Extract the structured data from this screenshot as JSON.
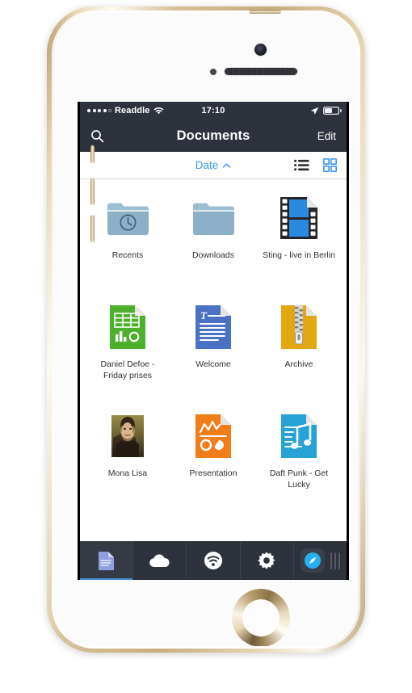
{
  "device": {
    "name": "iphone-5s-gold",
    "body_color": "#c6ad7f",
    "face_color": "#ffffff"
  },
  "status_bar": {
    "carrier": "Readdle",
    "signal_dots_filled": 4,
    "signal_dots_total": 5,
    "wifi_icon": "wifi-icon",
    "time": "17:10",
    "location_icon": "location-arrow-icon",
    "battery_icon": "battery-icon",
    "background": "#2e323c"
  },
  "nav_bar": {
    "search_icon": "search-icon",
    "title": "Documents",
    "edit_label": "Edit",
    "background": "#2e323c"
  },
  "sort_bar": {
    "sort_label": "Date",
    "sort_direction_icon": "chevron-up-icon",
    "accent_color": "#3b97f0",
    "views": [
      {
        "name": "list-view-toggle",
        "icon": "list-icon",
        "active": false,
        "color": "#2b2b2b"
      },
      {
        "name": "grid-view-toggle",
        "icon": "grid-icon",
        "active": true,
        "color": "#3b97f0"
      }
    ]
  },
  "files": [
    {
      "label": "Recents",
      "icon": "folder-clock-icon",
      "type": "folder"
    },
    {
      "label": "Downloads",
      "icon": "folder-icon",
      "type": "folder"
    },
    {
      "label": "Sting - live in Berlin",
      "icon": "video-film-icon",
      "type": "video"
    },
    {
      "label": "Daniel Defoe - Friday prises",
      "icon": "spreadsheet-icon",
      "type": "spreadsheet"
    },
    {
      "label": "Welcome",
      "icon": "text-document-icon",
      "type": "document"
    },
    {
      "label": "Archive",
      "icon": "zip-archive-icon",
      "type": "archive"
    },
    {
      "label": "Mona Lisa",
      "icon": "image-thumbnail-icon",
      "type": "image"
    },
    {
      "label": "Presentation",
      "icon": "presentation-icon",
      "type": "presentation"
    },
    {
      "label": "Daft Punk - Get Lucky",
      "icon": "music-note-icon",
      "type": "audio"
    }
  ],
  "tab_bar": {
    "background": "#2e323c",
    "active_indicator_color": "#4a90d9",
    "tabs": [
      {
        "name": "tab-documents",
        "icon": "document-icon",
        "active": true
      },
      {
        "name": "tab-network-cloud",
        "icon": "cloud-icon",
        "active": false
      },
      {
        "name": "tab-wifi-drive",
        "icon": "wifi-circle-icon",
        "active": false
      },
      {
        "name": "tab-settings",
        "icon": "gear-icon",
        "active": false
      },
      {
        "name": "tab-browser",
        "icon": "compass-browser-icon",
        "active": false
      }
    ]
  }
}
